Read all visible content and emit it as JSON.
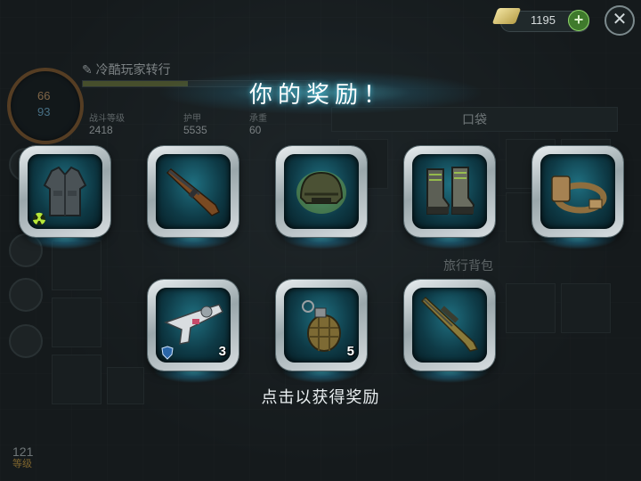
{
  "title": "你的奖励！",
  "hint": "点击以获得奖励",
  "currency": {
    "value": "1195",
    "plus": "+"
  },
  "close": "✕",
  "player": {
    "name": "冷酷玩家转行",
    "level_number": "121",
    "level_label": "等级",
    "vitals": {
      "stamina": "66",
      "water": "93"
    },
    "stats": [
      {
        "label": "战斗等级",
        "value": "2418"
      },
      {
        "label": "护甲",
        "value": "5535"
      },
      {
        "label": "承重",
        "value": "60"
      }
    ]
  },
  "inventory": {
    "pocket_label": "口袋",
    "bag_label": "旅行背包"
  },
  "rewards": [
    {
      "name": "armor-vest",
      "icon": "vest-icon",
      "qty": "",
      "badge": "radiation-badge-icon"
    },
    {
      "name": "rifle",
      "icon": "rifle-icon",
      "qty": ""
    },
    {
      "name": "helmet",
      "icon": "helmet-icon",
      "qty": ""
    },
    {
      "name": "boots",
      "icon": "boots-icon",
      "qty": ""
    },
    {
      "name": "belt",
      "icon": "belt-icon",
      "qty": ""
    },
    {
      "name": "repair-gun",
      "icon": "repair-gun-icon",
      "qty": "3",
      "badge": "shield-badge-icon"
    },
    {
      "name": "grenade",
      "icon": "grenade-icon",
      "qty": "5"
    },
    {
      "name": "sniper-rifle",
      "icon": "sniper-rifle-icon",
      "qty": ""
    }
  ],
  "colors": {
    "accent_glow": "#4fc8e1",
    "frame": "#c9d1d4",
    "slot_bg": "#0e3a46"
  }
}
